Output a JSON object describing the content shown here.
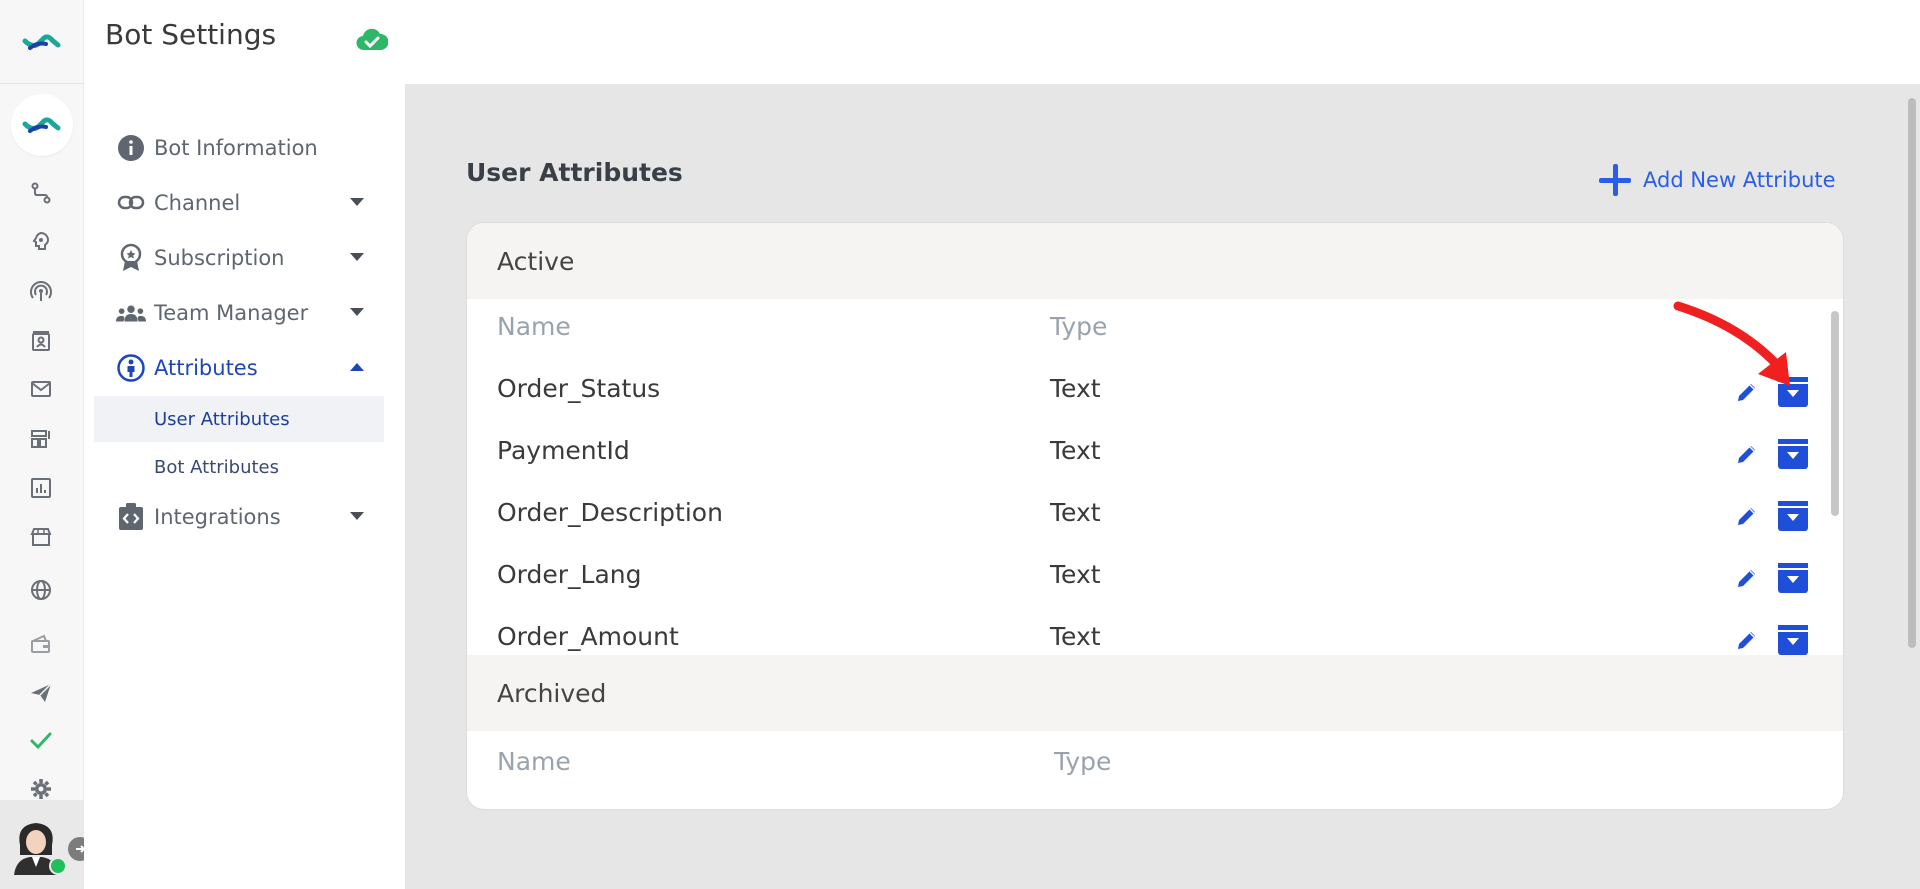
{
  "app": {
    "title": "Bot Settings",
    "accent": "#1d47b8",
    "link_color": "#2a5ee8",
    "status_icon": "cloud-check-icon",
    "status_color": "#2fb768"
  },
  "rail": {
    "icons": [
      "flow-icon",
      "brain-icon",
      "broadcast-icon",
      "contacts-icon",
      "mail-icon",
      "dashboard-icon",
      "analytics-icon",
      "store-icon",
      "globe-icon",
      "wallet-icon",
      "send-icon",
      "check-icon",
      "gear-icon"
    ]
  },
  "nav": {
    "bot_information": "Bot Information",
    "channel": "Channel",
    "subscription": "Subscription",
    "team_manager": "Team Manager",
    "attributes": "Attributes",
    "user_attributes": "User Attributes",
    "bot_attributes": "Bot Attributes",
    "integrations": "Integrations"
  },
  "main": {
    "section_title": "User Attributes",
    "add_label": "Add New Attribute",
    "active_label": "Active",
    "archived_label": "Archived",
    "col_name": "Name",
    "col_type": "Type",
    "rows": [
      {
        "name": "Order_Status",
        "type": "Text"
      },
      {
        "name": "PaymentId",
        "type": "Text"
      },
      {
        "name": "Order_Description",
        "type": "Text"
      },
      {
        "name": "Order_Lang",
        "type": "Text"
      },
      {
        "name": "Order_Amount",
        "type": "Text"
      }
    ]
  }
}
